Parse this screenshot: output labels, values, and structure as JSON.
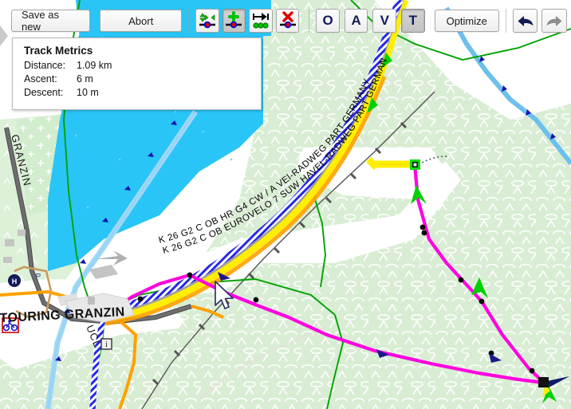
{
  "toolbar": {
    "save_label": "Save as new",
    "abort_label": "Abort",
    "optimize_label": "Optimize",
    "icon_buttons": [
      {
        "name": "move-point-icon",
        "title": "Move point"
      },
      {
        "name": "add-point-icon",
        "title": "Add point"
      },
      {
        "name": "shift-points-icon",
        "title": "Shift points"
      },
      {
        "name": "delete-point-icon",
        "title": "Delete point"
      }
    ],
    "letter_buttons": [
      {
        "label": "O",
        "active": false
      },
      {
        "label": "A",
        "active": false
      },
      {
        "label": "V",
        "active": false
      },
      {
        "label": "T",
        "active": true
      }
    ],
    "undo_label": "Undo",
    "redo_label": "Redo",
    "undo_enabled": true,
    "redo_enabled": false,
    "pressed_icon_index": 1
  },
  "metrics": {
    "title": "Track Metrics",
    "distance_label": "Distance:",
    "distance_value": "1.09 km",
    "ascent_label": "Ascent:",
    "ascent_value": "6 m",
    "descent_label": "Descent:",
    "descent_value": "10 m"
  },
  "map": {
    "labels": {
      "granzin_street": "GRANZIN",
      "touring_granzin": "TOURING GRANZIN",
      "ucl_road": "UCL",
      "cycle_route_1": "K 26  G2  C OB  HR  G4  CW / A VEl-RADWEG  PART  GERMANY",
      "cycle_route_2": "K 26  G2  C OB  EUROVELO 7  SUW  HAVEL-RADWEG  PART  GERMANY"
    },
    "colors": {
      "water": "#29c5f6",
      "forest": "#d6ecd2",
      "route_track": "#ff00e0",
      "cycle_route_casing": "#2a2ae0",
      "road_yellow": "#ffee00",
      "road_orange": "#ffa100",
      "green_boundary": "#00a100",
      "marker_start": "#00e000",
      "marker_black": "#000000",
      "background": "#ffffff"
    },
    "markers": {
      "start_marker": "green-square-marker",
      "end_marker": "black-square-marker",
      "waypoint": "black-dot-waypoint"
    },
    "poi": [
      {
        "name": "parking-icon",
        "label": "P"
      },
      {
        "name": "hospital-icon",
        "label": "H"
      },
      {
        "name": "bicycle-shop-icon",
        "label": "bicycle"
      },
      {
        "name": "information-icon",
        "label": "i"
      }
    ]
  }
}
